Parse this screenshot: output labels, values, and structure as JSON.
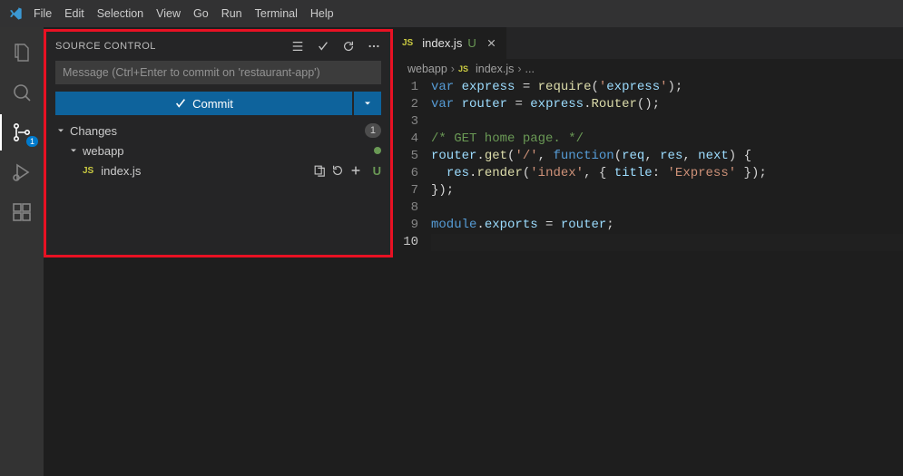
{
  "menubar": {
    "items": [
      "File",
      "Edit",
      "Selection",
      "View",
      "Go",
      "Run",
      "Terminal",
      "Help"
    ]
  },
  "activitybar": {
    "scm_badge": "1"
  },
  "scm": {
    "title": "SOURCE CONTROL",
    "input_placeholder": "Message (Ctrl+Enter to commit on 'restaurant-app')",
    "commit_label": "Commit",
    "tree": {
      "changes_label": "Changes",
      "changes_count": "1",
      "folder": "webapp",
      "file": {
        "icon_text": "JS",
        "name": "index.js",
        "status": "U"
      }
    }
  },
  "editor": {
    "tab": {
      "icon_text": "JS",
      "name": "index.js",
      "status": "U"
    },
    "breadcrumbs": {
      "p1": "webapp",
      "p2_icon": "JS",
      "p2": "index.js",
      "p3": "..."
    },
    "line_numbers": [
      "1",
      "2",
      "3",
      "4",
      "5",
      "6",
      "7",
      "8",
      "9",
      "10"
    ],
    "code_plain": [
      "var express = require('express');",
      "var router = express.Router();",
      "",
      "/* GET home page. */",
      "router.get('/', function(req, res, next) {",
      "  res.render('index', { title: 'Express' });",
      "});",
      "",
      "module.exports = router;",
      ""
    ]
  }
}
